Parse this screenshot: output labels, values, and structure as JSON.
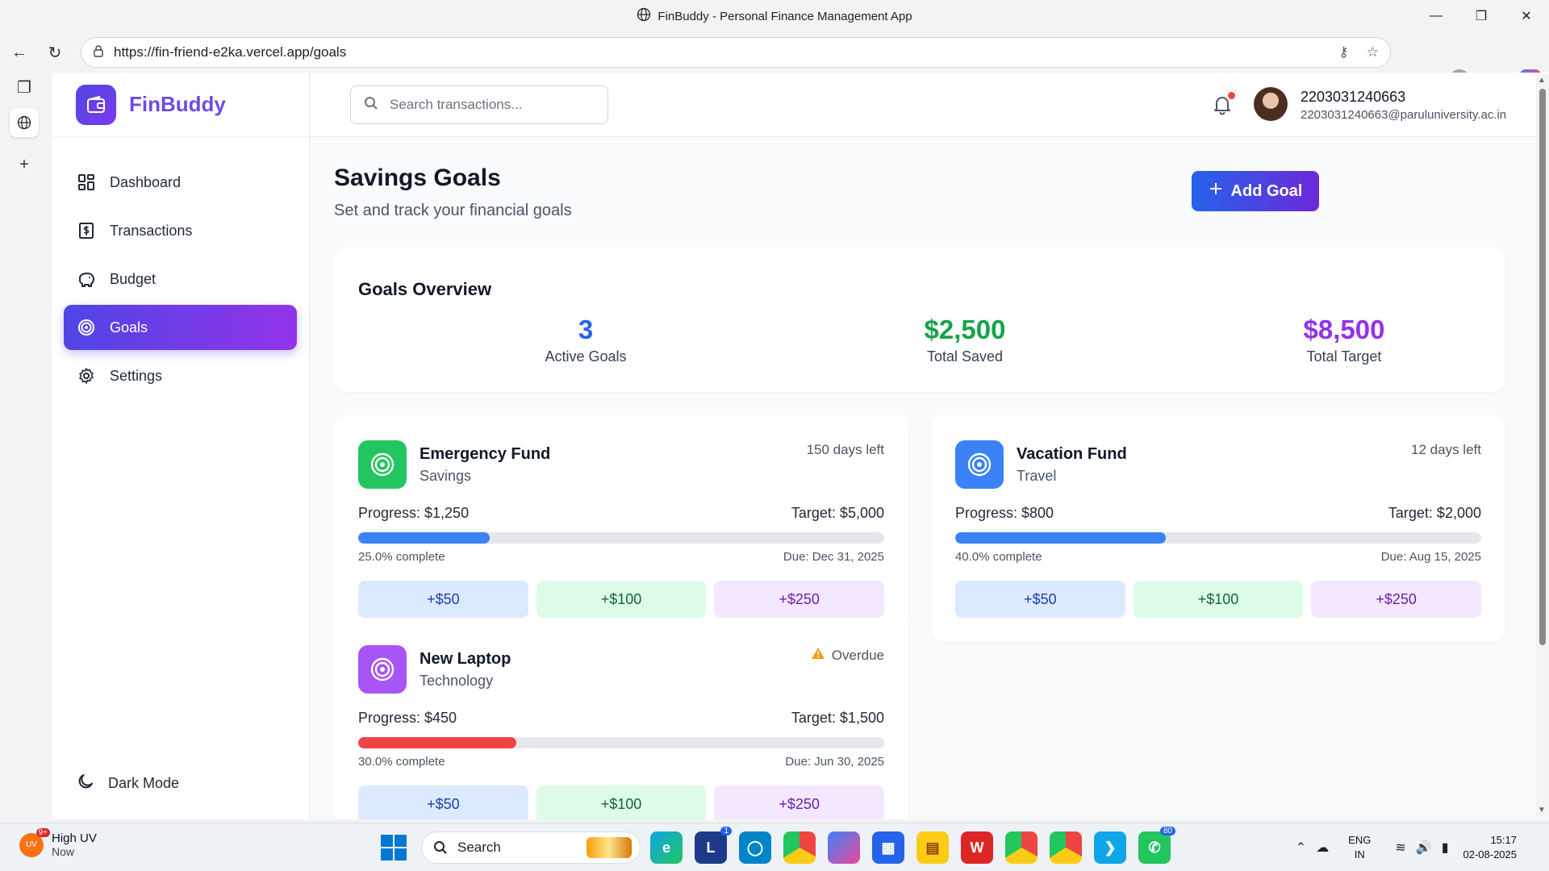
{
  "browser": {
    "window_title": "FinBuddy - Personal Finance Management App",
    "url": "https://fin-friend-e2ka.vercel.app/goals"
  },
  "app": {
    "brand": "FinBuddy",
    "nav": [
      {
        "label": "Dashboard",
        "icon": "dashboard-icon",
        "active": false
      },
      {
        "label": "Transactions",
        "icon": "transactions-icon",
        "active": false
      },
      {
        "label": "Budget",
        "icon": "piggy-bank-icon",
        "active": false
      },
      {
        "label": "Goals",
        "icon": "target-icon",
        "active": true
      },
      {
        "label": "Settings",
        "icon": "gear-icon",
        "active": false
      }
    ],
    "dark_mode_label": "Dark Mode",
    "search_placeholder": "Search transactions...",
    "user": {
      "name": "2203031240663",
      "email": "2203031240663@paruluniversity.ac.in"
    }
  },
  "page": {
    "title": "Savings Goals",
    "subtitle": "Set and track your financial goals",
    "add_button": "Add Goal"
  },
  "overview": {
    "title": "Goals Overview",
    "stats": [
      {
        "value": "3",
        "label": "Active Goals",
        "color": "#2563eb"
      },
      {
        "value": "$2,500",
        "label": "Total Saved",
        "color": "#16a34a"
      },
      {
        "value": "$8,500",
        "label": "Total Target",
        "color": "#9333ea"
      }
    ]
  },
  "goals": [
    {
      "name": "Emergency Fund",
      "category": "Savings",
      "days": "150 days left",
      "progress": "Progress: $1,250",
      "target": "Target: $5,000",
      "percent": 25,
      "percent_label": "25.0% complete",
      "due": "Due: Dec 31, 2025",
      "icon_color": "#22c55e",
      "bar_color": "#3b82f6",
      "overdue": false,
      "buttons": [
        "+$50",
        "+$100",
        "+$250"
      ]
    },
    {
      "name": "Vacation Fund",
      "category": "Travel",
      "days": "12 days left",
      "progress": "Progress: $800",
      "target": "Target: $2,000",
      "percent": 40,
      "percent_label": "40.0% complete",
      "due": "Due: Aug 15, 2025",
      "icon_color": "#3b82f6",
      "bar_color": "#3b82f6",
      "overdue": false,
      "buttons": [
        "+$50",
        "+$100",
        "+$250"
      ]
    },
    {
      "name": "New Laptop",
      "category": "Technology",
      "days": "Overdue",
      "progress": "Progress: $450",
      "target": "Target: $1,500",
      "percent": 30,
      "percent_label": "30.0% complete",
      "due": "Due: Jun 30, 2025",
      "icon_color": "#a855f7",
      "bar_color": "#ef4444",
      "overdue": true,
      "buttons": [
        "+$50",
        "+$100",
        "+$250"
      ]
    }
  ],
  "taskbar": {
    "weather_title": "High UV",
    "weather_sub": "Now",
    "weather_badge": "9+",
    "weather_icon_text": "UV",
    "search_label": "Search",
    "badges": {
      "l_app": "1",
      "whatsapp": "80"
    },
    "lang_1": "ENG",
    "lang_2": "IN",
    "time": "15:17",
    "date": "02-08-2025"
  }
}
